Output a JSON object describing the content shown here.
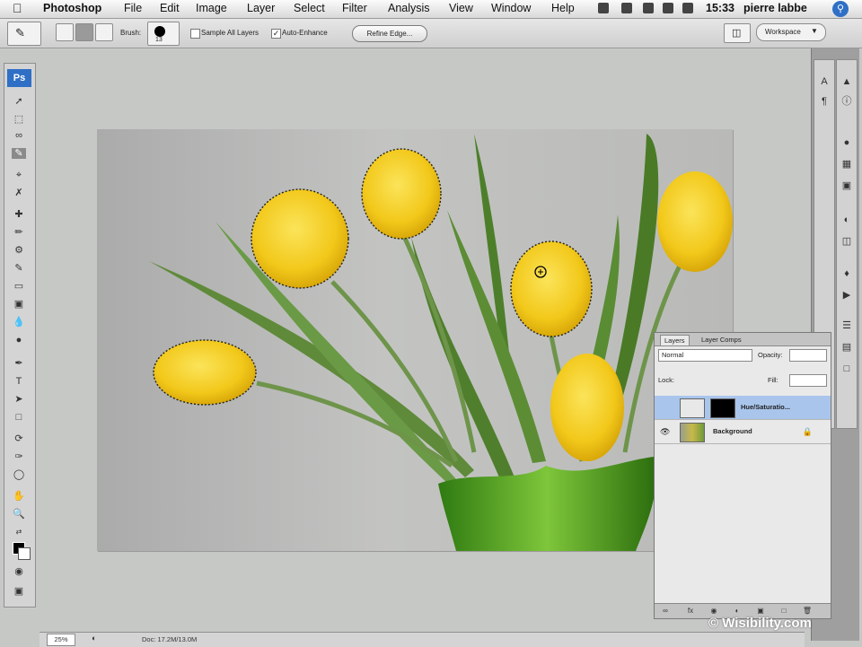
{
  "menubar": {
    "app_name": "Photoshop",
    "items": [
      "File",
      "Edit",
      "Image",
      "Layer",
      "Select",
      "Filter",
      "Analysis",
      "View",
      "Window",
      "Help"
    ],
    "clock": "15:33",
    "user": "pierre labbe"
  },
  "options_bar": {
    "brush_label": "Brush:",
    "brush_size": "13",
    "sample_all_layers_label": "Sample All Layers",
    "sample_all_layers_checked": false,
    "auto_enhance_label": "Auto-Enhance",
    "auto_enhance_checked": true,
    "refine_edge_label": "Refine Edge...",
    "workspace_label": "Workspace"
  },
  "toolbox": {
    "logo": "Ps",
    "selected_tool": "quick-selection-tool"
  },
  "layers_panel": {
    "tabs": [
      "Layers",
      "Layer Comps"
    ],
    "blend_mode": "Normal",
    "opacity_label": "Opacity:",
    "lock_label": "Lock:",
    "fill_label": "Fill:",
    "layers": [
      {
        "name": "Hue/Saturatio...",
        "selected": true,
        "visible": false
      },
      {
        "name": "Background",
        "selected": false,
        "visible": true
      }
    ]
  },
  "status_bar": {
    "zoom": "25%",
    "doc_info": "Doc: 17.2M/13.0M"
  },
  "watermark": "© Wisibility.com",
  "colors": {
    "accent": "#2f6fc5",
    "canvas_bg": "#c6c8c6",
    "selection_highlight": "#a9c5ec"
  }
}
